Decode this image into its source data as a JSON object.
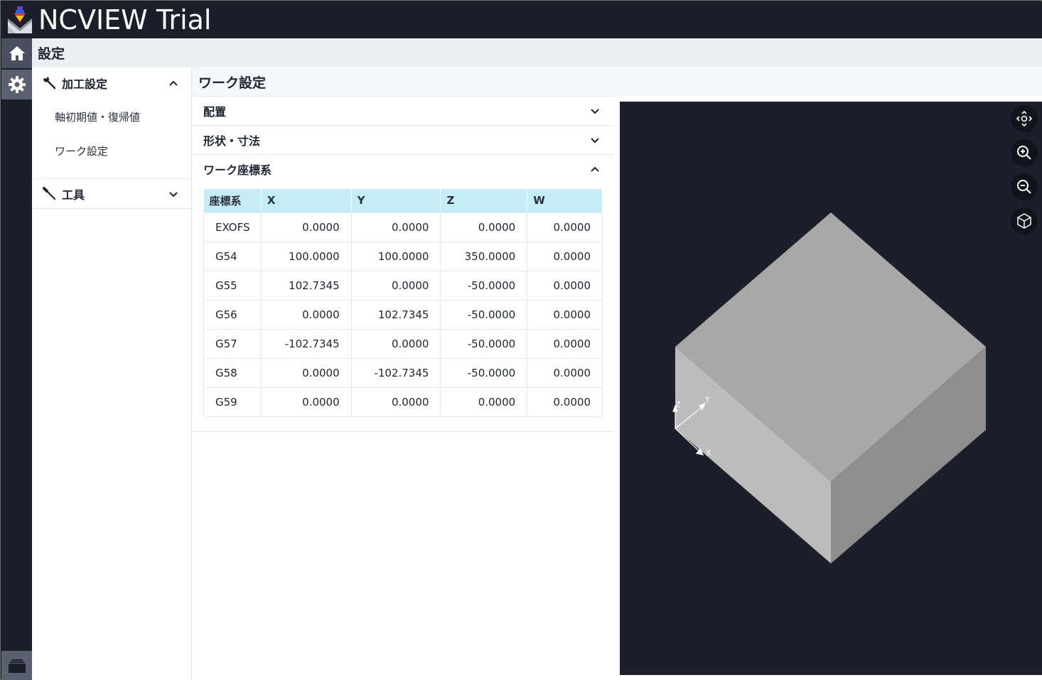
{
  "app": {
    "title": "NCVIEW Trial",
    "accent": "#1b1f2a"
  },
  "rail": {
    "items": [
      {
        "icon": "home-icon"
      },
      {
        "icon": "gear-icon"
      },
      {
        "icon": "layers-icon"
      }
    ]
  },
  "page": {
    "title": "設定"
  },
  "nav": {
    "group1": {
      "label": "加工設定",
      "icon": "wrench-icon",
      "expanded": true
    },
    "items": [
      {
        "label": "軸初期値・復帰値"
      },
      {
        "label": "ワーク設定"
      }
    ],
    "group2": {
      "label": "工具",
      "icon": "tool-icon",
      "expanded": false
    }
  },
  "section": {
    "title": "ワーク設定"
  },
  "accordion": {
    "placement": "配置",
    "shape": "形状・寸法",
    "wcs": "ワーク座標系"
  },
  "table": {
    "header_color": "#c4edf7",
    "columns": [
      "座標系",
      "X",
      "Y",
      "Z",
      "W"
    ],
    "rows": [
      [
        "EXOFS",
        "0.0000",
        "0.0000",
        "0.0000",
        "0.0000"
      ],
      [
        "G54",
        "100.0000",
        "100.0000",
        "350.0000",
        "0.0000"
      ],
      [
        "G55",
        "102.7345",
        "0.0000",
        "-50.0000",
        "0.0000"
      ],
      [
        "G56",
        "0.0000",
        "102.7345",
        "-50.0000",
        "0.0000"
      ],
      [
        "G57",
        "-102.7345",
        "0.0000",
        "-50.0000",
        "0.0000"
      ],
      [
        "G58",
        "0.0000",
        "-102.7345",
        "-50.0000",
        "0.0000"
      ],
      [
        "G59",
        "0.0000",
        "0.0000",
        "0.0000",
        "0.0000"
      ]
    ]
  },
  "viewer": {
    "buttons": [
      {
        "icon": "orbit-icon"
      },
      {
        "icon": "zoom-in-icon"
      },
      {
        "icon": "zoom-out-icon"
      },
      {
        "icon": "cube-view-icon"
      }
    ],
    "axes": {
      "x": "X",
      "y": "Y",
      "z": "Z"
    }
  }
}
